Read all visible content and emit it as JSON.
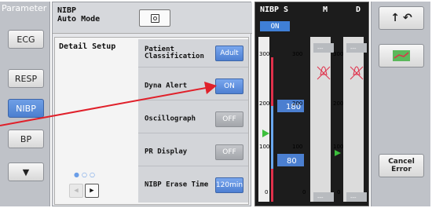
{
  "sidebar": {
    "title": "Parameter",
    "items": [
      {
        "label": "ECG"
      },
      {
        "label": "RESP"
      },
      {
        "label": "NIBP"
      },
      {
        "label": "BP"
      },
      {
        "label": "▼"
      }
    ]
  },
  "auto_mode": {
    "label_line1": "NIBP",
    "label_line2": "Auto Mode"
  },
  "detail": {
    "title": "Detail Setup",
    "options": [
      {
        "label": "Patient\nClassification",
        "value": "Adult"
      },
      {
        "label": "Dyna Alert",
        "value": "ON"
      },
      {
        "label": "Oscillograph",
        "value": "OFF"
      },
      {
        "label": "PR Display",
        "value": "OFF"
      },
      {
        "label": "NIBP Erase Time",
        "value": "120min"
      }
    ],
    "pager_dots": "●○○"
  },
  "nibp_panel": {
    "title": "NIBP",
    "col_s": "S",
    "col_m": "M",
    "col_d": "D",
    "status": "ON",
    "s_scale_top": "300",
    "s_scale_mid": "200",
    "s_scale_low": "100",
    "s_scale_bottom": "0",
    "m_scale_top": "300",
    "m_scale_mid": "200",
    "m_scale_low": "100",
    "m_scale_bottom": "0",
    "d_scale_top": "300",
    "d_scale_mid": "200",
    "d_scale_low": "100",
    "d_scale_bottom": "0",
    "upper_limit": "180",
    "lower_limit": "80",
    "dash": "---"
  },
  "right_panel": {
    "cancel_error": "Cancel\nError"
  },
  "colors": {
    "accent_blue": "#4b7fd0",
    "alarm_red": "#e0304a",
    "marker_green": "#3cbf3c",
    "annotation_red": "#e0202a"
  }
}
